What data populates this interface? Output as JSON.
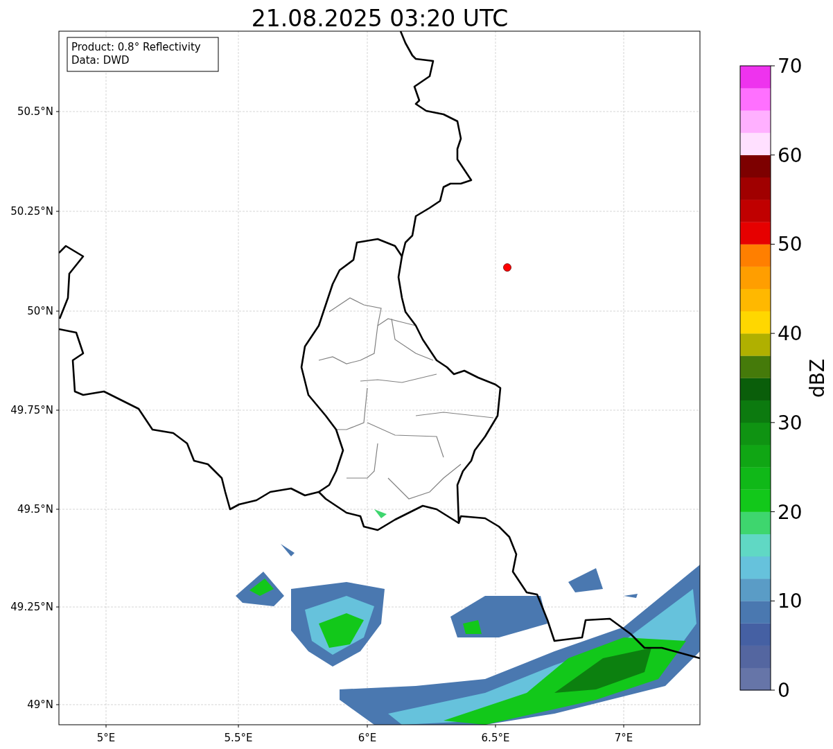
{
  "title": "21.08.2025 03:20 UTC",
  "legend": [
    "Product: 0.8° Reflectivity",
    "Data: DWD"
  ],
  "xticks": [
    "5°E",
    "5.5°E",
    "6°E",
    "6.5°E",
    "7°E"
  ],
  "yticks": [
    "50.5°N",
    "50.25°N",
    "50°N",
    "49.75°N",
    "49.5°N",
    "49.25°N",
    "49°N"
  ],
  "colorbar": {
    "label": "dBZ",
    "ticks": [
      "70",
      "60",
      "50",
      "40",
      "30",
      "20",
      "10",
      "0"
    ],
    "bands": [
      {
        "color": "#6675a8"
      },
      {
        "color": "#5466a0"
      },
      {
        "color": "#4560a3"
      },
      {
        "color": "#4a78b0"
      },
      {
        "color": "#5a9cc6"
      },
      {
        "color": "#66c2dc"
      },
      {
        "color": "#60d8c4"
      },
      {
        "color": "#3ed66e"
      },
      {
        "color": "#12c81a"
      },
      {
        "color": "#10b818"
      },
      {
        "color": "#10a614"
      },
      {
        "color": "#0f9312"
      },
      {
        "color": "#0c7a0f"
      },
      {
        "color": "#0a5e0a"
      },
      {
        "color": "#457a0a"
      },
      {
        "color": "#b0b000"
      },
      {
        "color": "#ffd700"
      },
      {
        "color": "#ffb800"
      },
      {
        "color": "#ff9e00"
      },
      {
        "color": "#ff7f00"
      },
      {
        "color": "#e60000"
      },
      {
        "color": "#c00000"
      },
      {
        "color": "#a00000"
      },
      {
        "color": "#7d0000"
      },
      {
        "color": "#ffe0ff"
      },
      {
        "color": "#ffb0ff"
      },
      {
        "color": "#ff70ff"
      },
      {
        "color": "#ee33ee"
      }
    ]
  }
}
